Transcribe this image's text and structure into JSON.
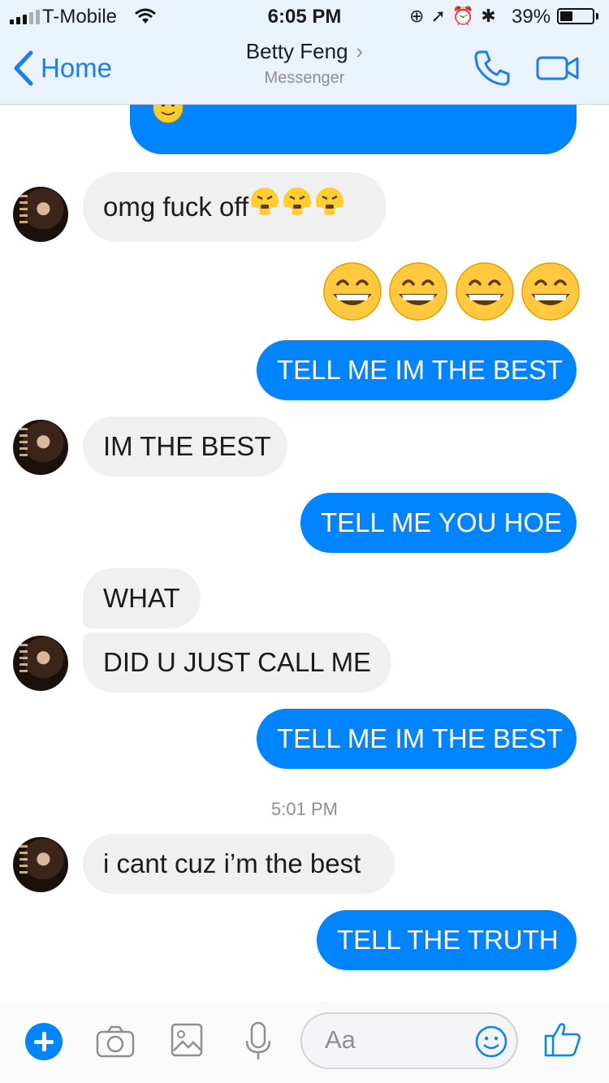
{
  "status_bar": {
    "carrier": "T-Mobile",
    "time": "6:05 PM",
    "battery_percent": "39%",
    "battery_level": 0.39
  },
  "header": {
    "back_label": "Home",
    "contact_name": "Betty Feng",
    "subtitle": "Messenger"
  },
  "messages": [
    {
      "side": "sent",
      "text": "",
      "emoji": "slightly-smiling-face"
    },
    {
      "side": "received",
      "text": "omg fuck off",
      "emoji": "face-with-steam-from-nose x3"
    },
    {
      "side": "sent",
      "text": "",
      "emoji": "grinning-face-with-smiling-eyes x4"
    },
    {
      "side": "sent",
      "text": "TELL ME IM THE BEST"
    },
    {
      "side": "received",
      "text": "IM THE BEST"
    },
    {
      "side": "sent",
      "text": "TELL ME YOU HOE"
    },
    {
      "side": "received",
      "text": "WHAT"
    },
    {
      "side": "received",
      "text": "DID U JUST CALL ME"
    },
    {
      "side": "sent",
      "text": "TELL ME IM THE BEST"
    },
    {
      "side": "received",
      "text": "i cant cuz i’m the best"
    },
    {
      "side": "sent",
      "text": "TELL THE TRUTH"
    }
  ],
  "timestamp": "5:01 PM",
  "composer": {
    "placeholder": "Aa"
  },
  "colors": {
    "accent": "#0084ff",
    "incoming_bubble": "#f1f0f0",
    "header_bg": "#eaf2fb"
  }
}
